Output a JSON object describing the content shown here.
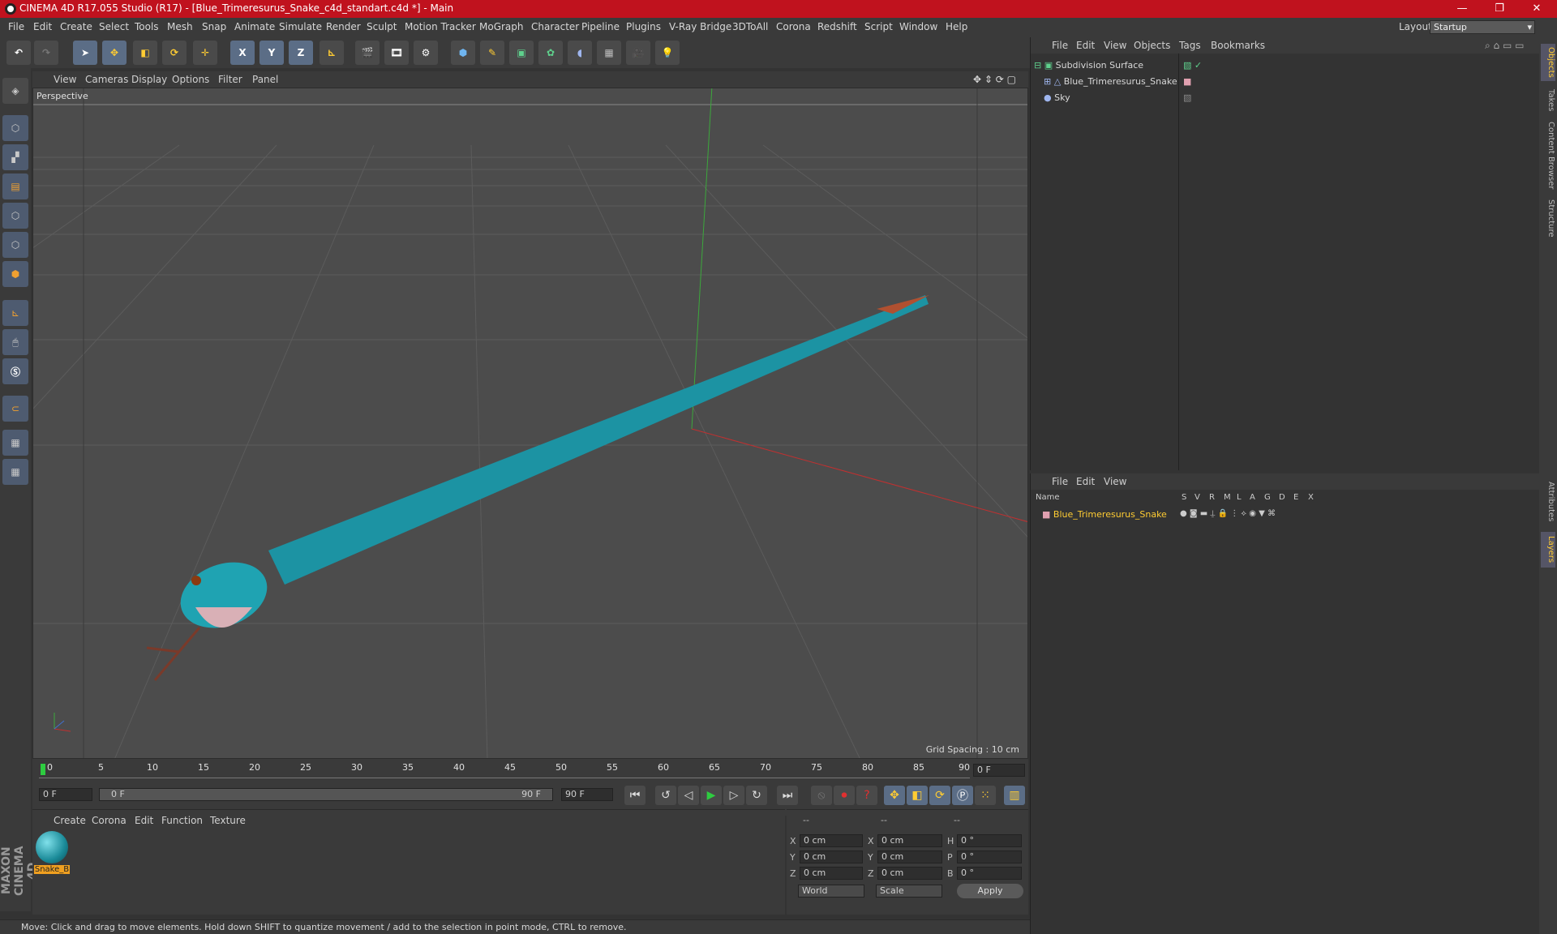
{
  "window": {
    "title": "CINEMA 4D R17.055 Studio (R17) - [Blue_Trimeresurus_Snake_c4d_standart.c4d *] - Main",
    "minimize": "—",
    "maximize": "❐",
    "close": "✕"
  },
  "menu": [
    "File",
    "Edit",
    "Create",
    "Select",
    "Tools",
    "Mesh",
    "Snap",
    "Animate",
    "Simulate",
    "Render",
    "Sculpt",
    "Motion Tracker",
    "MoGraph",
    "Character",
    "Pipeline",
    "Plugins",
    "V-Ray Bridge",
    "3DToAll",
    "Corona",
    "Redshift",
    "Script",
    "Window",
    "Help"
  ],
  "layout": {
    "label": "Layout:",
    "value": "Startup"
  },
  "toolbar_icons": [
    "undo-icon",
    "redo-icon",
    "select-icon",
    "move-icon",
    "scale-icon",
    "rotate-icon",
    "move-plus-icon",
    "x-axis-icon",
    "y-axis-icon",
    "z-axis-icon",
    "coord-system-icon",
    "render-view-icon",
    "render-region-icon",
    "render-settings-icon",
    "cube-icon",
    "pen-icon",
    "subdivision-icon",
    "cloner-icon",
    "deformer-icon",
    "floor-icon",
    "camera-icon",
    "light-icon"
  ],
  "axis_labels": {
    "x": "X",
    "y": "Y",
    "z": "Z"
  },
  "left_icons": [
    "make-editable-icon",
    "texture-mode-icon",
    "workplane-icon",
    "points-mode-icon",
    "edges-mode-icon",
    "polygons-mode-icon",
    "axis-icon",
    "tweak-icon",
    "snap-s-icon",
    "magnet-icon",
    "grid-lock-icon",
    "grid-snap-icon"
  ],
  "viewport": {
    "menu": [
      "View",
      "Cameras",
      "Display",
      "Options",
      "Filter",
      "Panel"
    ],
    "label": "Perspective",
    "grid_spacing": "Grid Spacing : 10 cm"
  },
  "timeline": {
    "ticks": [
      "0",
      "5",
      "10",
      "15",
      "20",
      "25",
      "30",
      "35",
      "40",
      "45",
      "50",
      "55",
      "60",
      "65",
      "70",
      "75",
      "80",
      "85",
      "90"
    ],
    "current_frame": "0 F",
    "start": "0 F",
    "slider_start": "0 F",
    "slider_end": "90 F",
    "end": "90 F"
  },
  "material_manager": {
    "menu": [
      "Create",
      "Corona",
      "Edit",
      "Function",
      "Texture"
    ],
    "material_name": "Snake_B"
  },
  "coordinates": {
    "header": [
      "--",
      "--",
      "--"
    ],
    "rows": [
      {
        "a": "X",
        "av": "0 cm",
        "b": "X",
        "bv": "0 cm",
        "c": "H",
        "cv": "0 °"
      },
      {
        "a": "Y",
        "av": "0 cm",
        "b": "Y",
        "bv": "0 cm",
        "c": "P",
        "cv": "0 °"
      },
      {
        "a": "Z",
        "av": "0 cm",
        "b": "Z",
        "bv": "0 cm",
        "c": "B",
        "cv": "0 °"
      }
    ],
    "mode": "World",
    "scale": "Scale",
    "apply": "Apply"
  },
  "objects": {
    "menu": [
      "File",
      "Edit",
      "View",
      "Objects",
      "Tags",
      "Bookmarks"
    ],
    "items": [
      "Subdivision Surface",
      "Blue_Trimeresurus_Snake",
      "Sky"
    ]
  },
  "layers": {
    "menu": [
      "File",
      "Edit",
      "View"
    ],
    "columns": [
      "Name",
      "S",
      "V",
      "R",
      "M",
      "L",
      "A",
      "G",
      "D",
      "E",
      "X"
    ],
    "items": [
      "Blue_Trimeresurus_Snake"
    ]
  },
  "right_tabs": [
    "Objects",
    "Takes",
    "Content Browser",
    "Structure",
    "Attributes",
    "Layers"
  ],
  "status": "Move: Click and drag to move elements. Hold down SHIFT to quantize movement / add to the selection in point mode, CTRL to remove.",
  "brand": "MAXON CINEMA 4D",
  "colors": {
    "title_bar": "#c0121e",
    "snake": "#1fa3b2",
    "accent": "#ffcc33"
  }
}
